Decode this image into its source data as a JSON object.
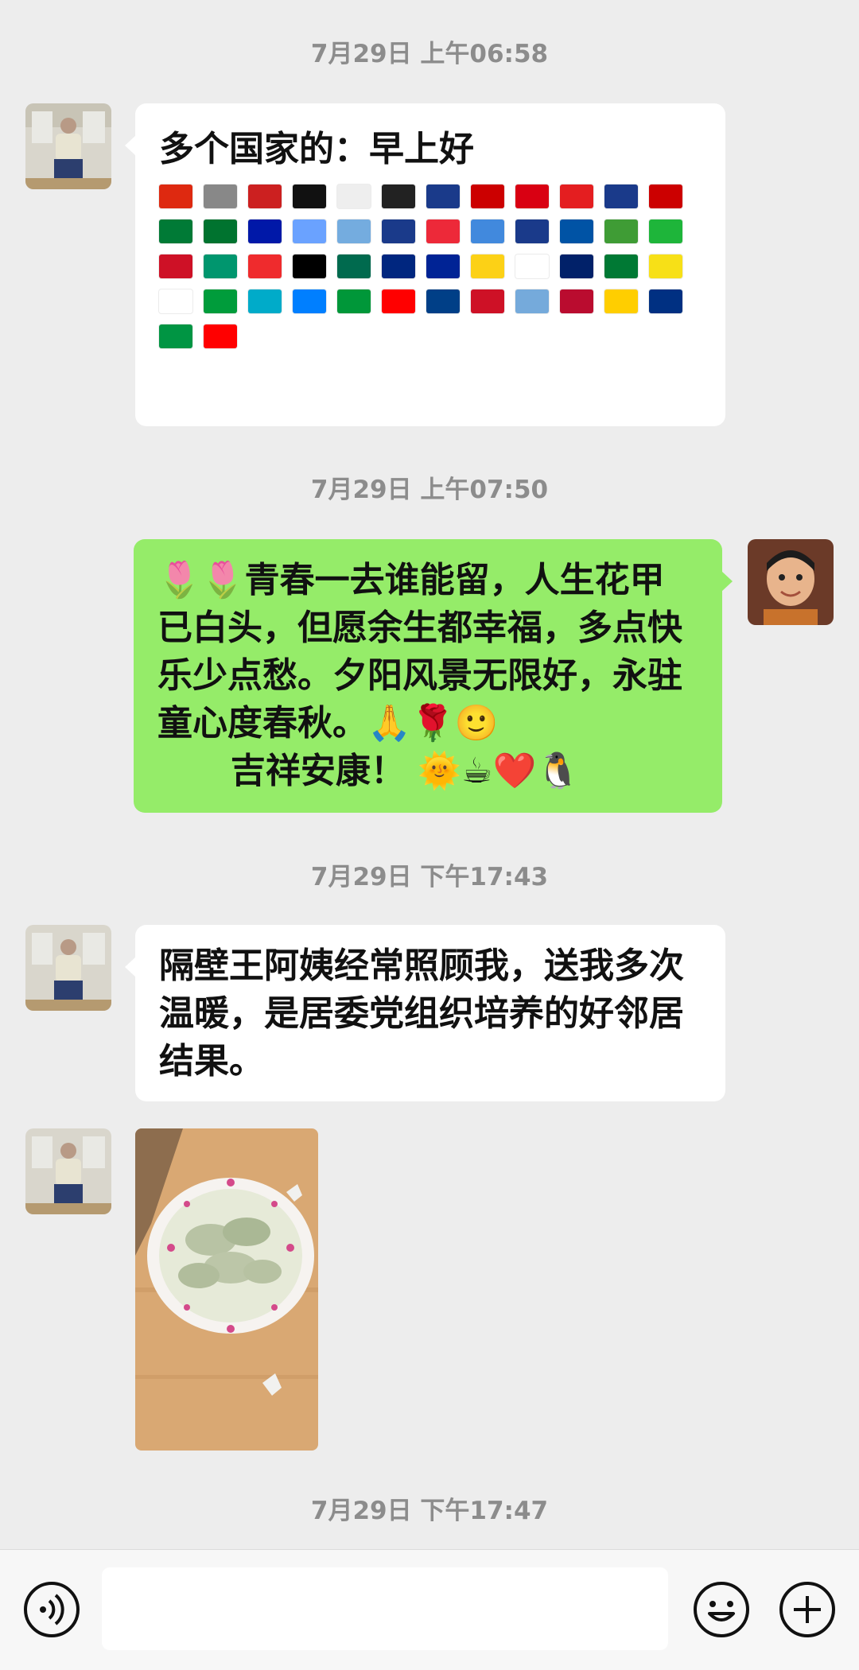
{
  "timestamps": [
    "7月29日 上午06:58",
    "7月29日 上午07:50",
    "7月29日 下午17:43",
    "7月29日 下午17:47"
  ],
  "messages": {
    "m1_title": "多个国家的：早上好",
    "m2_text": "🌷🌷青春一去谁能留，人生花甲已白头，但愿余生都幸福，多点快乐少点愁。夕阳风景无限好，永驻童心度春秋。🙏🌹🙂",
    "m2_line2": "      吉祥安康！ 🌞☕❤️🐧",
    "m3_text": "隔壁王阿姨经常照顾我，送我多次温暖，是居委党组织培养的好邻居结果。"
  },
  "flag_colors": [
    "#de2910",
    "#888888",
    "#cc2020",
    "#111111",
    "#eeeeee",
    "#222222",
    "#1a3a8a",
    "#cc0000",
    "#d90012",
    "#e41e20",
    "#1a3a8a",
    "#cc0000",
    "#007a36",
    "#00732f",
    "#0018a8",
    "#6aa2ff",
    "#74acdf",
    "#1a3a8a",
    "#ed2939",
    "#4189dd",
    "#1a3a8a",
    "#0053a5",
    "#3f9c35",
    "#1eb53a",
    "#ce1126",
    "#00966e",
    "#ef2b2d",
    "#000000",
    "#006a4e",
    "#00267f",
    "#002395",
    "#fcd116",
    "#ffffff",
    "#012169",
    "#007934",
    "#f7e017",
    "#ffffff",
    "#009c3b",
    "#00abc9",
    "#007fff",
    "#009739",
    "#ff0000",
    "#003f87",
    "#ce1126",
    "#75aadb",
    "#ba0c2f",
    "#ffce00",
    "#003082",
    "#009543",
    "#ff0000"
  ],
  "input": {
    "placeholder": ""
  },
  "icons": [
    "voice-icon",
    "emoji-icon",
    "plus-icon"
  ],
  "colors": {
    "bg": "#ededed",
    "green_bubble": "#95ec69",
    "white_bubble": "#ffffff"
  }
}
